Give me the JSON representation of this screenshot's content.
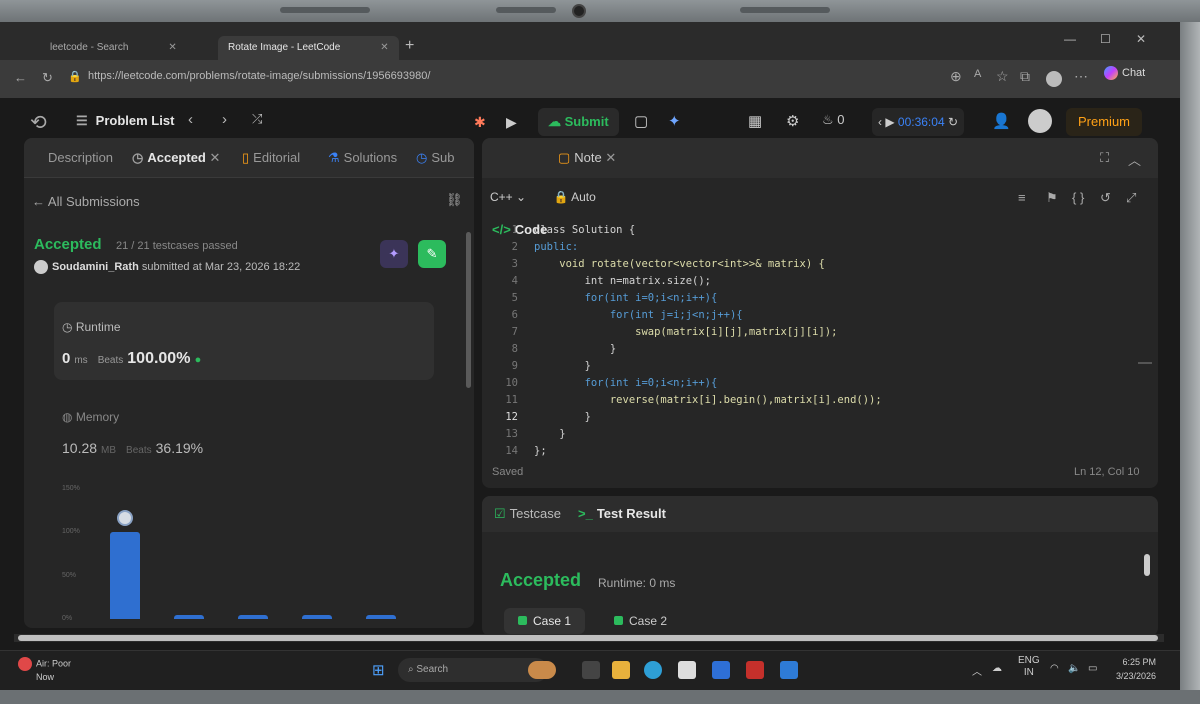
{
  "browser": {
    "tabs": [
      {
        "label": "leetcode - Search",
        "close": "✕"
      },
      {
        "label": "Rotate Image - LeetCode",
        "close": "✕"
      }
    ],
    "new_tab": "+",
    "url": "https://leetcode.com/problems/rotate-image/submissions/1956693980/",
    "chat_label": "Chat",
    "window_controls": [
      "—",
      "☐",
      "✕"
    ]
  },
  "nav": {
    "problem_list": "Problem List",
    "submit": "Submit",
    "streak": "0",
    "timer": "00:36:04",
    "premium": "Premium"
  },
  "left": {
    "tabs": {
      "description": "Description",
      "accepted": "Accepted",
      "editorial": "Editorial",
      "solutions": "Solutions",
      "submissions": "Sub"
    },
    "all_submissions": "All Submissions",
    "status": "Accepted",
    "testcases": "21 / 21 testcases passed",
    "username": "Soudamini_Rath",
    "submitted_at": "submitted at Mar 23, 2026 18:22",
    "runtime": {
      "label": "Runtime",
      "value": "0",
      "unit": "ms",
      "beats_label": "Beats",
      "beats": "100.00%"
    },
    "memory": {
      "label": "Memory",
      "value": "10.28",
      "unit": "MB",
      "beats_label": "Beats",
      "beats": "36.19%"
    }
  },
  "chart_data": {
    "type": "bar",
    "yticks": [
      "150%",
      "100%",
      "50%",
      "0%"
    ],
    "ylim": [
      0,
      150
    ],
    "values": [
      100,
      4,
      4,
      4,
      4
    ],
    "highlight_index": 0
  },
  "editor": {
    "tabs": {
      "code": "Code",
      "note": "Note"
    },
    "language": "C++",
    "mode": "Auto",
    "status": "Saved",
    "cursor": "Ln 12, Col 10",
    "lines": [
      {
        "n": "1",
        "text": "class Solution {"
      },
      {
        "n": "2",
        "text": "public:"
      },
      {
        "n": "3",
        "text": "    void rotate(vector<vector<int>>& matrix) {"
      },
      {
        "n": "4",
        "text": "        int n=matrix.size();"
      },
      {
        "n": "5",
        "text": "        for(int i=0;i<n;i++){"
      },
      {
        "n": "6",
        "text": "            for(int j=i;j<n;j++){"
      },
      {
        "n": "7",
        "text": "                swap(matrix[i][j],matrix[j][i]);"
      },
      {
        "n": "8",
        "text": "            }"
      },
      {
        "n": "9",
        "text": "        }"
      },
      {
        "n": "10",
        "text": "        for(int i=0;i<n;i++){"
      },
      {
        "n": "11",
        "text": "            reverse(matrix[i].begin(),matrix[i].end());"
      },
      {
        "n": "12",
        "text": "        }"
      },
      {
        "n": "13",
        "text": "    }"
      },
      {
        "n": "14",
        "text": "};"
      }
    ]
  },
  "result": {
    "tabs": {
      "testcase": "Testcase",
      "test_result": "Test Result"
    },
    "status": "Accepted",
    "runtime": "Runtime: 0 ms",
    "cases": [
      "Case 1",
      "Case 2"
    ]
  },
  "taskbar": {
    "weather_line1": "Air: Poor",
    "weather_line2": "Now",
    "search": "Search",
    "lang_line1": "ENG",
    "lang_line2": "IN",
    "time": "6:25 PM",
    "date": "3/23/2026"
  }
}
